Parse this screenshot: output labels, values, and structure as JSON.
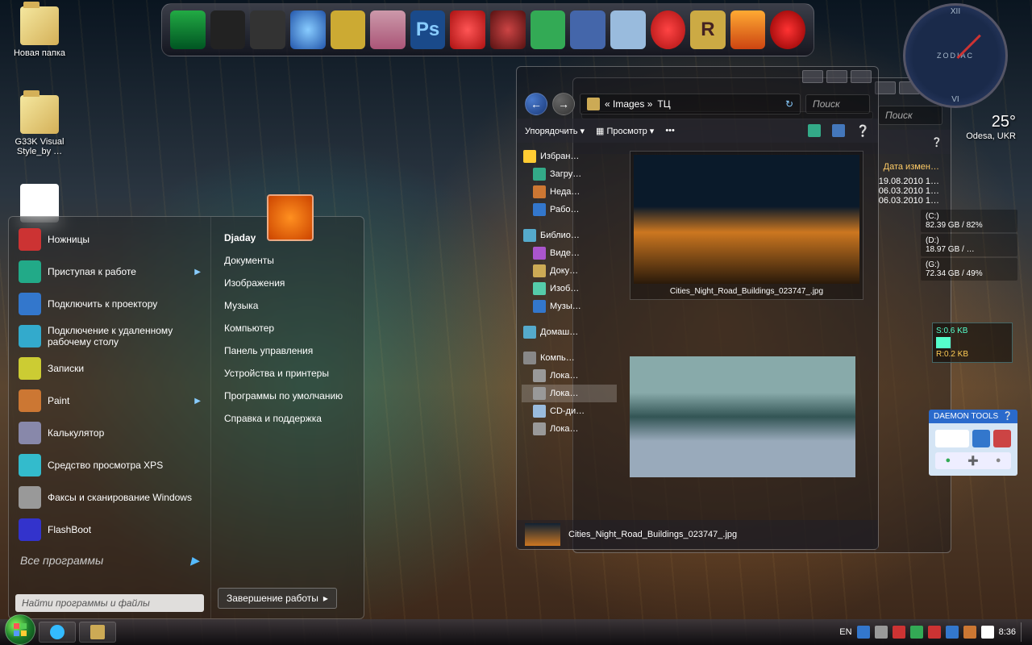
{
  "desktop_icons": [
    {
      "label": "Новая папка"
    },
    {
      "label": "G33K Visual Style_by …"
    }
  ],
  "dock_items": [
    "media",
    "remote",
    "photos",
    "safari",
    "car",
    "pics",
    "Ps",
    "apple",
    "disc",
    "utor",
    "phone",
    "trash",
    "clock",
    "R",
    "fire",
    "power"
  ],
  "start_menu": {
    "user": "Djaday",
    "left_items": [
      {
        "label": "Ножницы",
        "color": "#c33",
        "arrow": false
      },
      {
        "label": "Приступая к работе",
        "color": "#2a8",
        "arrow": true
      },
      {
        "label": "Подключить к проектору",
        "color": "#37c",
        "arrow": false
      },
      {
        "label": "Подключение к удаленному рабочему столу",
        "color": "#3ac",
        "arrow": false
      },
      {
        "label": "Записки",
        "color": "#cc3",
        "arrow": false
      },
      {
        "label": "Paint",
        "color": "#c73",
        "arrow": true
      },
      {
        "label": "Калькулятор",
        "color": "#88a",
        "arrow": false
      },
      {
        "label": "Средство просмотра XPS",
        "color": "#3bc",
        "arrow": false
      },
      {
        "label": "Факсы и сканирование Windows",
        "color": "#999",
        "arrow": false
      },
      {
        "label": "FlashBoot",
        "color": "#33c",
        "arrow": false
      }
    ],
    "all_programs": "Все программы",
    "search_placeholder": "Найти программы и файлы",
    "right_items": [
      "Djaday",
      "Документы",
      "Изображения",
      "Музыка",
      "Компьютер",
      "Панель управления",
      "Устройства и принтеры",
      "Программы по умолчанию",
      "Справка и поддержка"
    ],
    "shutdown": "Завершение работы"
  },
  "explorer": {
    "breadcrumb": [
      "« Images »",
      "ТЦ"
    ],
    "search_placeholder": "Поиск",
    "toolbar": {
      "organize": "Упорядочить",
      "view": "Просмотр"
    },
    "tree": {
      "favorites": {
        "header": "Избран…",
        "items": [
          "Загру…",
          "Неда…",
          "Рабо…"
        ]
      },
      "libraries": {
        "header": "Библио…",
        "items": [
          "Виде…",
          "Доку…",
          "Изоб…",
          "Музы…"
        ]
      },
      "home": "Домаш…",
      "computer": {
        "header": "Компь…",
        "items": [
          "Лока…",
          "Лока…",
          "CD-ди…",
          "Лока…"
        ]
      }
    },
    "thumb_caption": "Cities_Night_Road_Buildings_023747_.jpg",
    "status_filename": "Cities_Night_Road_Buildings_023747_.jpg",
    "back_window": {
      "col_date": "Дата измен…",
      "rows": [
        "19.08.2010 1…",
        "06.03.2010 1…",
        "06.03.2010 1…"
      ]
    }
  },
  "gadgets": {
    "clock_brand": "ZODIAC",
    "weather": {
      "temp": "25°",
      "location": "Odesa, UKR"
    },
    "drives": [
      {
        "label": "(C:)",
        "info": "82.39 GB / 82%"
      },
      {
        "label": "(D:)",
        "info": "18.97 GB / …"
      },
      {
        "label": "(G:)",
        "info": "72.34 GB / 49%"
      }
    ],
    "netmon": {
      "send": "S:0.6 KB",
      "recv": "R:0.2 KB"
    },
    "daemon_title": "DAEMON TOOLS"
  },
  "taskbar": {
    "lang": "EN",
    "time": "8:36"
  }
}
